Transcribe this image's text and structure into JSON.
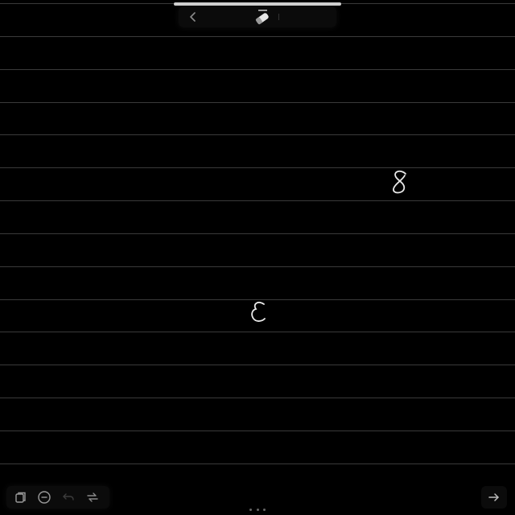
{
  "canvas": {
    "background": "#000000",
    "line_color": "#3a3a3a",
    "ink_color": "#e8e8e8"
  },
  "top_toolbar": {
    "back_icon": "chevron-left-icon",
    "tool_icon": "eraser-icon"
  },
  "handwriting": [
    {
      "name": "handwritten-digit-8",
      "text": "8"
    },
    {
      "name": "handwritten-digit-3-mirrored",
      "text": "3"
    }
  ],
  "bottom_toolbar": {
    "icons": [
      "copy-page-icon",
      "zoom-out-icon",
      "undo-icon",
      "redo-icon"
    ]
  },
  "next_page_icon": "arrow-right-icon"
}
